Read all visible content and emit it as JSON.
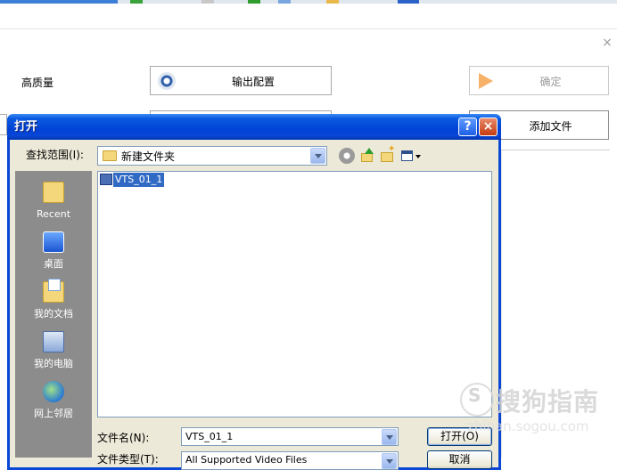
{
  "app": {
    "close_glyph": "×",
    "quality_label": "高质量",
    "output_config_label": "输出配置",
    "confirm_label": "确定",
    "add_file_label": "添加文件"
  },
  "dialog": {
    "title": "打开",
    "help_glyph": "?",
    "close_glyph": "×",
    "look_in_label": "查找范围(I):",
    "look_in_value": "新建文件夹",
    "places": [
      {
        "label": "Recent",
        "icon": "recent-folder-icon"
      },
      {
        "label": "桌面",
        "icon": "desktop-icon"
      },
      {
        "label": "我的文档",
        "icon": "my-documents-icon"
      },
      {
        "label": "我的电脑",
        "icon": "my-computer-icon"
      },
      {
        "label": "网上邻居",
        "icon": "network-icon"
      }
    ],
    "files": [
      {
        "name": "VTS_01_1",
        "selected": true,
        "icon": "video-file-icon"
      }
    ],
    "filename_label": "文件名(N):",
    "filename_value": "VTS_01_1",
    "filetype_label": "文件类型(T):",
    "filetype_value": "All Supported Video Files",
    "open_label": "打开(O)",
    "cancel_label": "取消"
  },
  "watermark": {
    "text": "搜狗指南",
    "url": "zhinan.sogou.com"
  },
  "colors": {
    "titlebar_blue": "#0a46d7",
    "dialog_face": "#ece9d8",
    "places_bar": "#8c8c8c",
    "selection": "#316ac5"
  }
}
